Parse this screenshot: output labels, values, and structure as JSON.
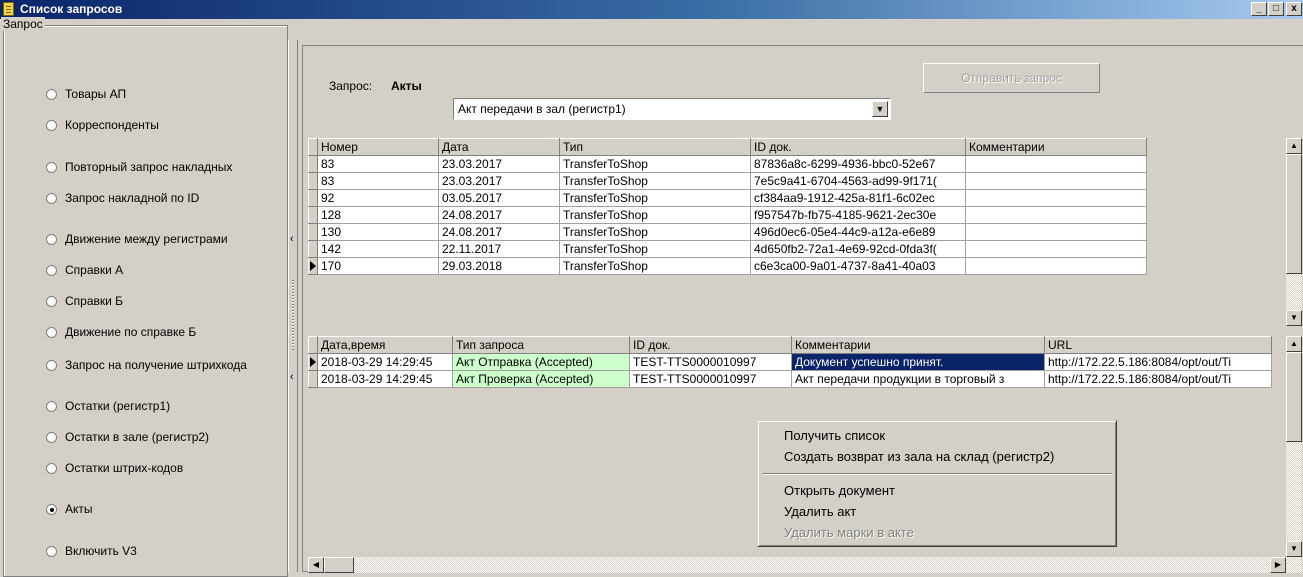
{
  "window": {
    "title": "Список запросов",
    "controls": [
      "_",
      "□",
      "x"
    ]
  },
  "request_group": {
    "label": "Запрос",
    "options": [
      {
        "label": "Товары АП",
        "checked": false
      },
      {
        "label": "Корреспонденты",
        "checked": false
      },
      {
        "label": "Повторный запрос накладных",
        "checked": false
      },
      {
        "label": "Запрос накладной по ID",
        "checked": false
      },
      {
        "label": "Движение между регистрами",
        "checked": false
      },
      {
        "label": "Справки А",
        "checked": false
      },
      {
        "label": "Справки Б",
        "checked": false
      },
      {
        "label": "Движение по справке Б",
        "checked": false
      },
      {
        "label": "Запрос на получение штрихкода",
        "checked": false
      },
      {
        "label": "Остатки (регистр1)",
        "checked": false
      },
      {
        "label": "Остатки в зале (регистр2)",
        "checked": false
      },
      {
        "label": "Остатки штрих-кодов",
        "checked": false
      },
      {
        "label": "Акты",
        "checked": true
      },
      {
        "label": "Включить V3",
        "checked": false
      }
    ]
  },
  "query": {
    "label": "Запрос:",
    "value": "Акты",
    "combo_value": "Акт передачи в зал  (регистр1)",
    "send_button": "Отправить запрос"
  },
  "docs_grid": {
    "columns": [
      "Номер",
      "Дата",
      "Тип",
      "ID док.",
      "Комментарии"
    ],
    "rows": [
      [
        "83",
        "23.03.2017",
        "TransferToShop",
        "87836a8c-6299-4936-bbc0-52e67",
        ""
      ],
      [
        "83",
        "23.03.2017",
        "TransferToShop",
        "7e5c9a41-6704-4563-ad99-9f171(",
        ""
      ],
      [
        "92",
        "03.05.2017",
        "TransferToShop",
        "cf384aa9-1912-425a-81f1-6c02ec",
        ""
      ],
      [
        "128",
        "24.08.2017",
        "TransferToShop",
        "f957547b-fb75-4185-9621-2ec30e",
        ""
      ],
      [
        "130",
        "24.08.2017",
        "TransferToShop",
        "496d0ec6-05e4-44c9-a12a-e6e89",
        ""
      ],
      [
        "142",
        "22.11.2017",
        "TransferToShop",
        "4d650fb2-72a1-4e69-92cd-0fda3f(",
        ""
      ],
      [
        "170",
        "29.03.2018",
        "TransferToShop",
        "c6e3ca00-9a01-4737-8a41-40a03",
        ""
      ]
    ],
    "current_row": 6
  },
  "log_grid": {
    "columns": [
      "Дата,время",
      "Тип запроса",
      "ID док.",
      "Комментарии",
      "URL"
    ],
    "rows": [
      [
        "2018-03-29 14:29:45",
        "Акт Отправка (Accepted)",
        "TEST-TTS0000010997",
        "Документ успешно принят.",
        "http://172.22.5.186:8084/opt/out/Ti"
      ],
      [
        "2018-03-29 14:29:45",
        "Акт Проверка (Accepted)",
        "TEST-TTS0000010997",
        "Акт передачи продукции в торговый з",
        "http://172.22.5.186:8084/opt/out/Ti"
      ]
    ],
    "current_row": 0
  },
  "context_menu": {
    "items": [
      {
        "label": "Получить список",
        "enabled": true
      },
      {
        "label": "Создать возврат из зала на склад (регистр2)",
        "enabled": true
      },
      {
        "label": "Открыть документ",
        "enabled": true
      },
      {
        "label": "Удалить акт",
        "enabled": true
      },
      {
        "label": "Удалить марки в акте",
        "enabled": false
      }
    ]
  },
  "colors": {
    "title_start": "#0a246a",
    "title_end": "#a6caf0",
    "accepted_cell": "#ccffcc",
    "selection": "#0a246a"
  }
}
